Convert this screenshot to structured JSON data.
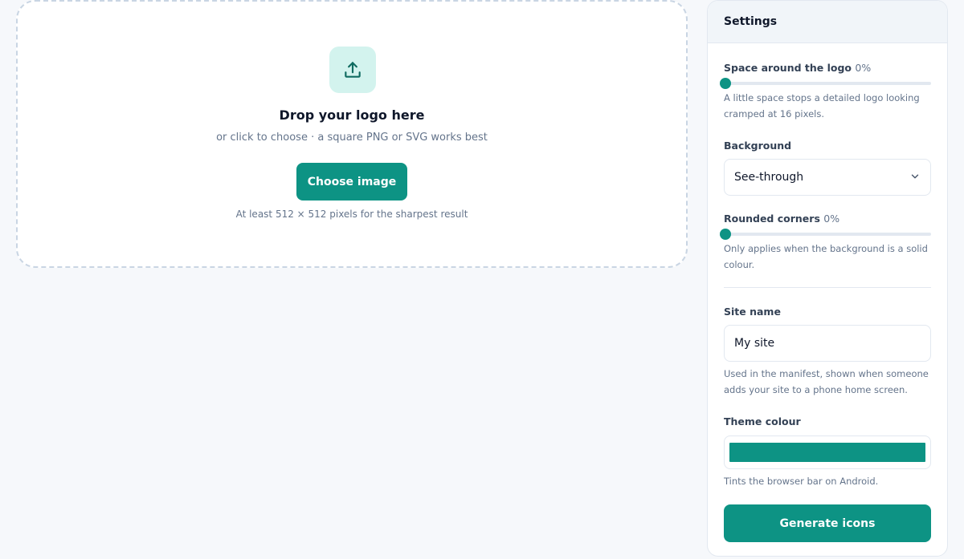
{
  "colors": {
    "accent": "#0d9384",
    "upload_badge_bg": "#d3f3ee",
    "theme_colour_value": "#0d9384"
  },
  "dropzone": {
    "icon": "upload-icon",
    "title": "Drop your logo here",
    "subtitle": "or click to choose · a square PNG or SVG works best",
    "button_label": "Choose image",
    "hint": "At least 512 × 512 pixels for the sharpest result"
  },
  "settings": {
    "title": "Settings",
    "padding": {
      "label": "Space around the logo",
      "value_text": "0%",
      "value": 0,
      "help": "A little space stops a detailed logo looking cramped at 16 pixels."
    },
    "background": {
      "label": "Background",
      "selected": "See-through",
      "icon": "chevron-down-icon"
    },
    "corners": {
      "label": "Rounded corners",
      "value_text": "0%",
      "value": 0,
      "help": "Only applies when the background is a solid colour."
    },
    "site_name": {
      "label": "Site name",
      "value": "My site",
      "help": "Used in the manifest, shown when someone adds your site to a phone home screen."
    },
    "theme_colour": {
      "label": "Theme colour",
      "help": "Tints the browser bar on Android."
    },
    "generate_label": "Generate icons"
  }
}
